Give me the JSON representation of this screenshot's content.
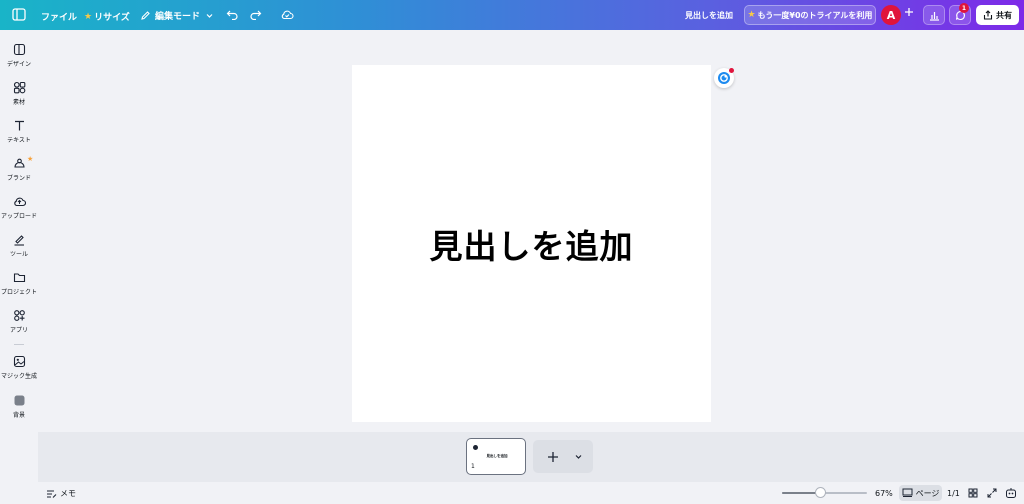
{
  "topbar": {
    "file_label": "ファイル",
    "resize_label": "リサイズ",
    "edit_mode_label": "編集モード",
    "add_heading_label": "見出しを追加",
    "trial_label": "もう一度¥0のトライアルを利用",
    "avatar_letter": "A",
    "notification_count": "1",
    "share_label": "共有"
  },
  "sidebar": {
    "items": [
      {
        "label": "デザイン",
        "icon": "design-icon"
      },
      {
        "label": "素材",
        "icon": "elements-icon"
      },
      {
        "label": "テキスト",
        "icon": "text-icon"
      },
      {
        "label": "ブランド",
        "icon": "brand-icon"
      },
      {
        "label": "アップロード",
        "icon": "upload-icon"
      },
      {
        "label": "ツール",
        "icon": "draw-icon"
      },
      {
        "label": "プロジェクト",
        "icon": "folder-icon"
      },
      {
        "label": "アプリ",
        "icon": "apps-icon"
      },
      {
        "label": "マジック生成",
        "icon": "magic-media-icon"
      },
      {
        "label": "背景",
        "icon": "background-icon"
      }
    ]
  },
  "canvas": {
    "heading": "見出しを追加"
  },
  "pages": {
    "thumb_number": "1",
    "thumb_text": "見出しを追加"
  },
  "bottombar": {
    "notes_label": "メモ",
    "zoom_level": "67%",
    "zoom_fraction": 0.45,
    "pages_label": "ページ",
    "page_count": "1/1"
  },
  "colors": {
    "brand_gradient_start": "#19b4c8",
    "brand_gradient_end": "#7d2ae8",
    "avatar": "#e0143c",
    "star": "#f7c948"
  }
}
